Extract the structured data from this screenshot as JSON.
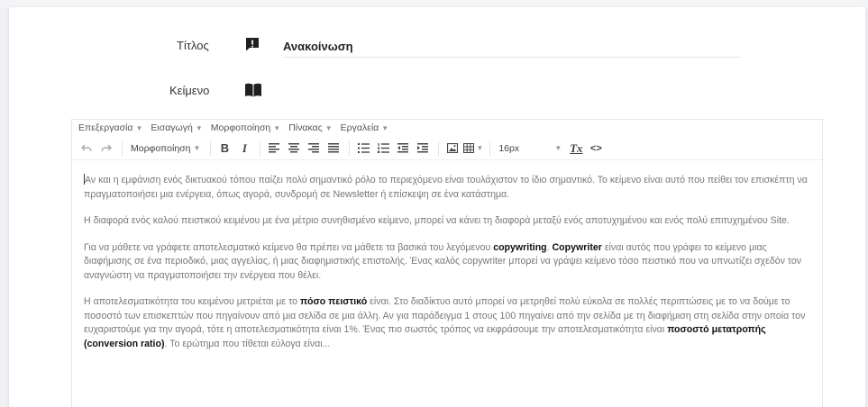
{
  "form": {
    "title_label": "Τίτλος",
    "title_value": "Ανακοίνωση",
    "text_label": "Κείμενο"
  },
  "editor": {
    "menus": [
      "Επεξεργασία",
      "Εισαγωγή",
      "Μορφοποίηση",
      "Πίνακας",
      "Εργαλεία"
    ],
    "format_select": "Μορφοποίηση",
    "font_size": "16px",
    "bold_glyph": "B",
    "italic_glyph": "I",
    "clear_glyph": "Tx",
    "code_glyph": "<>",
    "paragraphs": [
      [
        {
          "t": "Αν και η εμφάνιση ενός δικτυακού τόπου παίζει πολύ σημαντικό ρόλο το περιεχόμενο είναι τουλάχιστον το ίδιο σημαντικό. Το κείμενο είναι αυτό που πείθει τον επισκέπτη να πραγματοποιήσει μια ενέργεια, όπως αγορά, συνδρομή σε Newsletter ή επίσκεψη σε ένα κατάστημα."
        }
      ],
      [
        {
          "t": "Η διαφορά ενός καλού πειστικού κειμένου με ένα μέτριο συνηθισμένο κείμενο, μπορεί να κάνει τη διαφορά μεταξύ ενός αποτυχημένου και ενός πολύ επιτυχημένου Site."
        }
      ],
      [
        {
          "t": "Για να μάθετε να γράφετε αποτελεσματικό κείμενο θα πρέπει να μάθετε τα βασικά του λεγόμενου "
        },
        {
          "b": "copywriting"
        },
        {
          "t": ". "
        },
        {
          "b": "Copywriter"
        },
        {
          "t": " είναι αυτός που γράφει το κείμενο μιας διαφήμισης σε ένα περιοδικό, μιας αγγελίας, ή μιας διαφημιστικής επιστολής. Ένας καλός copywriter μπορεί να γράψει κείμενο τόσο πειστικό που να υπνωτίζει σχεδόν τον αναγνώστη να πραγματοποιήσει την ενέργεια που θέλει."
        }
      ],
      [
        {
          "t": "Η αποτελεσματικότητα του κειμένου μετριέται με το "
        },
        {
          "b": "πόσο πειστικό"
        },
        {
          "t": " είναι. Στο διαδίκτυο αυτό μπορεί να μετρηθεί πολύ εύκολα σε πολλές περιπτώσεις με το να δούμε το ποσοστό των επισκεπτών που πηγαίνουν από μια σελίδα σε μια άλλη. Αν για παράδειγμα 1 στους 100 πηγαίνει από την σελίδα με τη διαφήμιση στη σελίδα στην οποία τον ευχαριστούμε για την αγορά, τότε η αποτελεσματικότητα είναι 1%. Ένας πιο σωστός τρόπος να εκφράσουμε την αποτελεσματικότητα είναι "
        },
        {
          "b": "ποσοστό μετατροπής (conversion ratio)"
        },
        {
          "t": ". Το ερώτημα που τίθεται εύλογα είναι..."
        }
      ]
    ]
  }
}
